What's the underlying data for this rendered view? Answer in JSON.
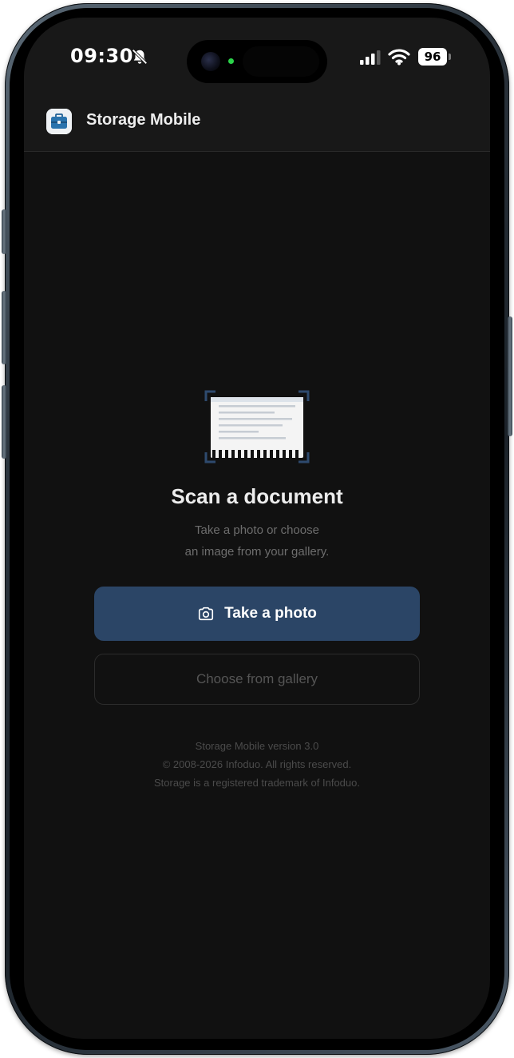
{
  "status_bar": {
    "time": "09:30",
    "battery_level": "96",
    "silent_icon": "bell-slash-icon",
    "signal_icon": "cellular-signal-icon",
    "wifi_icon": "wifi-icon"
  },
  "header": {
    "app_name": "Storage Mobile",
    "logo_icon": "briefcase-icon"
  },
  "main": {
    "illustration_icon": "document-scan-icon",
    "title": "Scan a document",
    "subtitle_line1": "Take a photo or choose",
    "subtitle_line2": "an image from your gallery.",
    "primary_button": {
      "label": "Take a photo",
      "icon": "camera-icon"
    },
    "secondary_button": {
      "label": "Choose from gallery"
    }
  },
  "footer": {
    "version": "Storage Mobile version 3.0",
    "copyright": "© 2008-2026 Infoduo. All rights reserved.",
    "trademark": "Storage is a registered trademark of Infoduo."
  },
  "colors": {
    "background": "#111111",
    "header_bg": "#181818",
    "accent": "#2b4566",
    "title_text": "#ececec",
    "muted_text": "#6d6d6d"
  }
}
